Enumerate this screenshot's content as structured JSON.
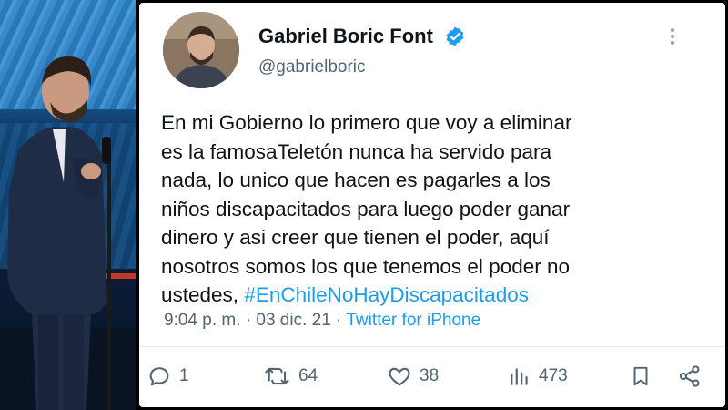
{
  "tweet": {
    "author_name": "Gabriel Boric Font",
    "handle": "@gabrielboric",
    "text_lines": [
      "En mi Gobierno lo primero que voy a eliminar",
      "es la famosaTeletón nunca ha servido para",
      "nada, lo unico que hacen es pagarles a los",
      "niños discapacitados para luego poder ganar",
      "dinero y asi creer que tienen el poder, aquí",
      "nosotros somos los que tenemos el poder no"
    ],
    "last_line_prefix": "ustedes, ",
    "hashtag": "#EnChileNoHayDiscapacitados",
    "timestamp": "9:04 p. m. · 03 dic. 21 · ",
    "source": "Twitter for iPhone"
  },
  "actions": {
    "replies": "1",
    "retweets": "64",
    "likes": "38",
    "views": "473"
  },
  "colors": {
    "accent": "#1d9bf0",
    "text": "#0f1419",
    "secondary": "#536471"
  },
  "icons": [
    "verified-badge-icon",
    "more-options-icon",
    "reply-icon",
    "retweet-icon",
    "like-icon",
    "views-icon",
    "bookmark-icon",
    "share-icon"
  ]
}
